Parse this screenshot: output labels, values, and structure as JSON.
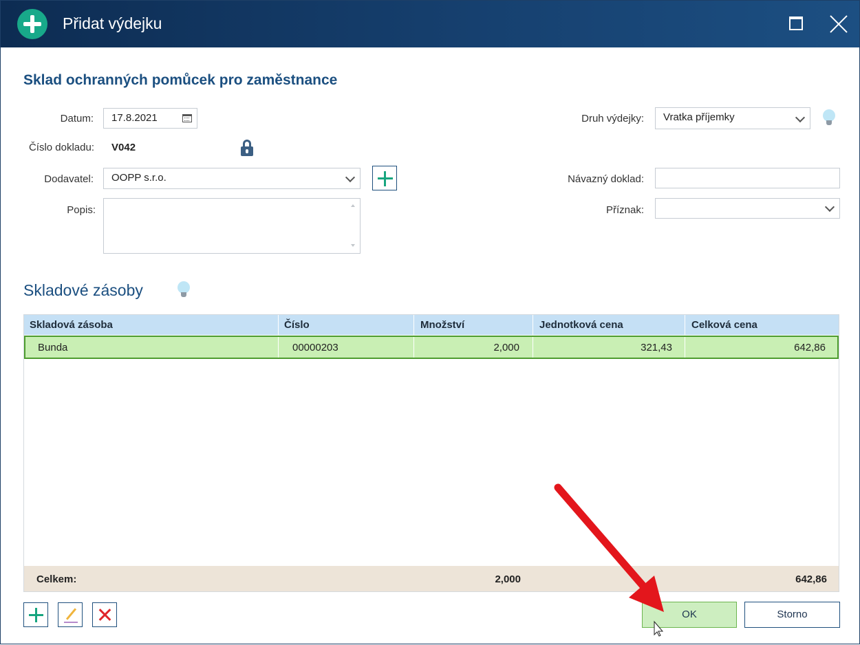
{
  "window": {
    "title": "Přidat výdejku"
  },
  "form": {
    "heading": "Sklad ochranných pomůcek pro zaměstnance",
    "datum_label": "Datum:",
    "datum_value": "17.8.2021",
    "cislo_label": "Číslo dokladu:",
    "cislo_value": "V042",
    "dodavatel_label": "Dodavatel:",
    "dodavatel_value": "OOPP s.r.o.",
    "popis_label": "Popis:",
    "popis_value": "",
    "druh_label": "Druh výdejky:",
    "druh_value": "Vratka příjemky",
    "navazny_label": "Návazný doklad:",
    "navazny_value": "",
    "priznak_label": "Příznak:",
    "priznak_value": ""
  },
  "stock": {
    "title": "Skladové zásoby",
    "columns": [
      "Skladová zásoba",
      "Číslo",
      "Množství",
      "Jednotková cena",
      "Celková cena"
    ],
    "rows": [
      {
        "zasoba": "Bunda",
        "cislo": "00000203",
        "mnozstvi": "2,000",
        "jednotkova": "321,43",
        "celkova": "642,86"
      }
    ],
    "total_label": "Celkem:",
    "total_mnozstvi": "2,000",
    "total_celkova": "642,86"
  },
  "buttons": {
    "ok": "OK",
    "cancel": "Storno"
  },
  "icons": {
    "title": "plus-circle-icon",
    "calendar": "calendar-icon",
    "lock": "lock-icon",
    "hint": "lightbulb-icon",
    "add": "plus-icon",
    "edit": "pencil-icon",
    "delete": "x-icon"
  },
  "colors": {
    "titlebar": "#16406f",
    "accent_green": "#17a57f",
    "heading": "#1b4f80",
    "selected_row": "#c9efb4",
    "total_row": "#ede4d8",
    "header_row": "#c5e0f5",
    "annotation_arrow": "#e3161c"
  }
}
